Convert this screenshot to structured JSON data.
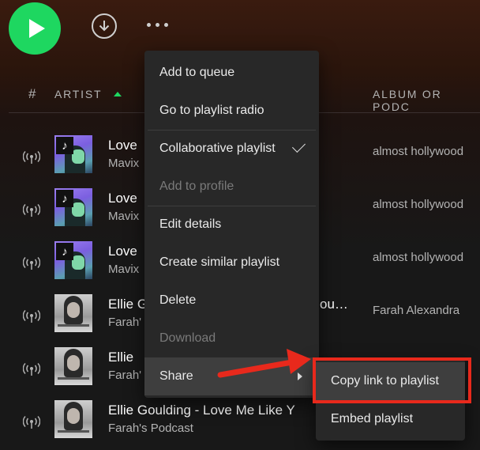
{
  "colors": {
    "accent": "#1ed760",
    "annotation": "#e8291c"
  },
  "controls": {
    "play_icon": "play-icon",
    "download_icon": "download-icon",
    "more_icon": "more-icon"
  },
  "header": {
    "hash": "#",
    "artist": "ARTIST",
    "album": "ALBUM OR PODC"
  },
  "rows": [
    {
      "title": "Love",
      "subtitle": "Mavix",
      "album": "almost hollywood",
      "thumb": "tiktok"
    },
    {
      "title": "Love",
      "subtitle": "Mavix",
      "album": "almost hollywood",
      "thumb": "tiktok"
    },
    {
      "title": "Love",
      "subtitle": "Mavix",
      "album": "almost hollywood",
      "thumb": "tiktok"
    },
    {
      "title": "Ellie G",
      "title_tail": "ou…",
      "subtitle": "Farah'",
      "album": "Farah Alexandra",
      "thumb": "ellie"
    },
    {
      "title": "Ellie",
      "subtitle": "Farah'",
      "album": "",
      "thumb": "ellie"
    },
    {
      "title": "Ellie Goulding - Love Me Like Y",
      "subtitle": "Farah's Podcast",
      "album": "",
      "thumb": "ellie"
    }
  ],
  "menu": {
    "items": [
      {
        "label": "Add to queue"
      },
      {
        "label": "Go to playlist radio"
      },
      {
        "label": "Collaborative playlist"
      },
      {
        "label": "Add to profile"
      },
      {
        "label": "Edit details"
      },
      {
        "label": "Create similar playlist"
      },
      {
        "label": "Delete"
      },
      {
        "label": "Download"
      },
      {
        "label": "Share"
      }
    ]
  },
  "submenu": {
    "items": [
      {
        "label": "Copy link to playlist"
      },
      {
        "label": "Embed playlist"
      }
    ]
  }
}
